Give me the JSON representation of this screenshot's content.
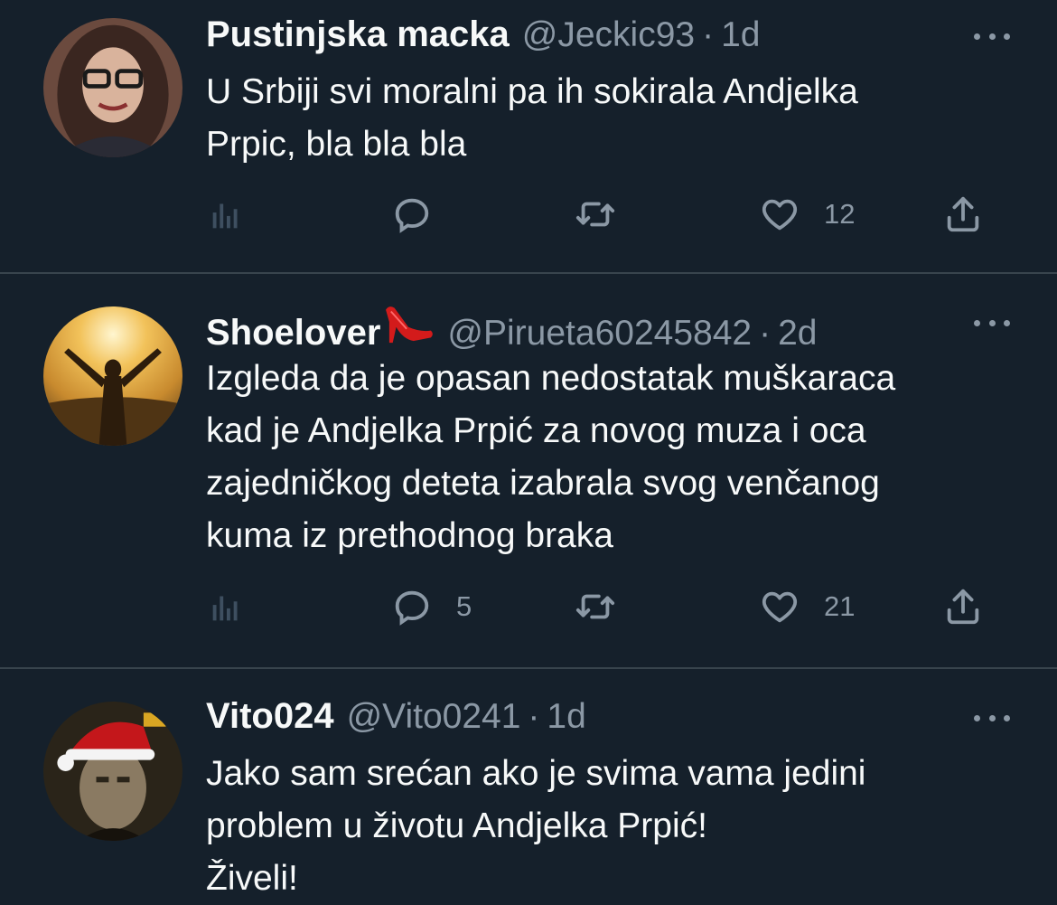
{
  "colors": {
    "background": "#15202b",
    "text": "#f7f9f9",
    "muted": "#8b98a5",
    "divider": "#38444d"
  },
  "tweets": [
    {
      "name": "Pustinjska macka",
      "handle": "@Jeckic93",
      "separator": "·",
      "time": "1d",
      "lines": [
        "U Srbiji svi moralni pa ih sokirala Andjelka",
        "Prpic, bla bla bla"
      ],
      "replies": "",
      "retweets": "",
      "likes": "12"
    },
    {
      "name": "Shoelover",
      "name_emoji": "high-heel-shoe-icon",
      "handle": "@Pirueta60245842",
      "separator": "·",
      "time": "2d",
      "lines": [
        "Izgleda da je opasan nedostatak muškaraca",
        "kad je Andjelka Prpić za novog muza i oca",
        "zajedničkog deteta izabrala svog venčanog",
        "kuma iz prethodnog braka"
      ],
      "replies": "5",
      "retweets": "",
      "likes": "21"
    },
    {
      "name": "Vito024",
      "handle": "@Vito0241",
      "separator": "·",
      "time": "1d",
      "lines": [
        "Jako sam srećan ako je svima vama jedini",
        "problem u životu Andjelka Prpić!",
        "Živeli!"
      ]
    }
  ]
}
